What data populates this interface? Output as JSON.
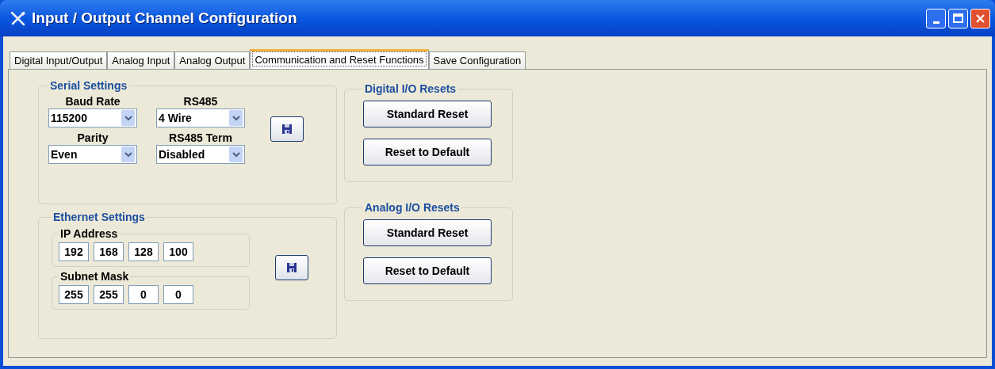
{
  "window": {
    "title": "Input / Output Channel Configuration"
  },
  "tabs": [
    {
      "label": "Digital Input/Output",
      "selected": false
    },
    {
      "label": "Analog Input",
      "selected": false
    },
    {
      "label": "Analog Output",
      "selected": false
    },
    {
      "label": "Communication and Reset Functions",
      "selected": true
    },
    {
      "label": "Save Configuration",
      "selected": false
    }
  ],
  "serial_settings": {
    "title": "Serial Settings",
    "fields": [
      {
        "label": "Baud Rate",
        "value": "115200"
      },
      {
        "label": "RS485",
        "value": "4 Wire"
      },
      {
        "label": "Parity",
        "value": "Even"
      },
      {
        "label": "RS485 Term",
        "value": "Disabled"
      }
    ]
  },
  "ethernet_settings": {
    "title": "Ethernet Settings",
    "addresses": [
      {
        "label": "IP Address",
        "octets": [
          "192",
          "168",
          "128",
          "100"
        ]
      },
      {
        "label": "Subnet Mask",
        "octets": [
          "255",
          "255",
          "0",
          "0"
        ]
      }
    ]
  },
  "reset_groups": [
    {
      "title": "Digital I/O Resets",
      "buttons": [
        "Standard Reset",
        "Reset to Default"
      ]
    },
    {
      "title": "Analog I/O Resets",
      "buttons": [
        "Standard Reset",
        "Reset to Default"
      ]
    }
  ]
}
